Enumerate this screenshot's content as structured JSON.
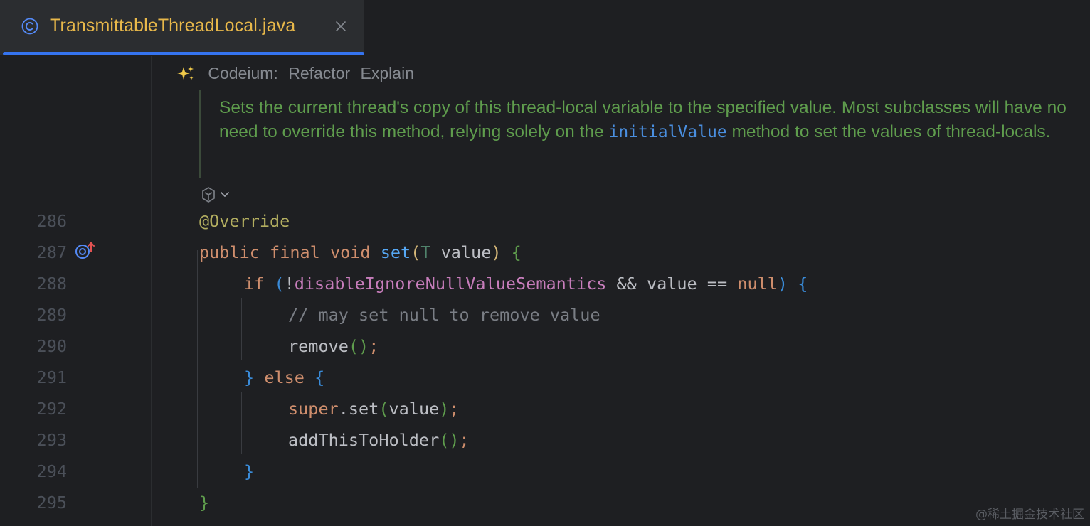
{
  "tab": {
    "title": "TransmittableThreadLocal.java",
    "file_type_icon": "class-c-icon",
    "close_icon": "close-x-icon",
    "accent_color": "#3574f0"
  },
  "codeium_lens": {
    "icon": "sparkle-icon",
    "label": "Codeium:",
    "actions": [
      "Refactor",
      "Explain"
    ]
  },
  "doc_comment": {
    "part1": "Sets the current thread's copy of this thread-local variable to the specified value. Most subclasses will have no need to override this method, relying solely on the ",
    "code_ref": "initialValue",
    "part2": " method to set the values of thread-locals.",
    "toggle_icon": "ai-render-toggle-icon"
  },
  "gutter": {
    "override_marker_icon": "overrides-method-icon"
  },
  "lines": [
    {
      "number": "286",
      "tokens": [
        {
          "t": "@Override",
          "c": "ann"
        }
      ]
    },
    {
      "number": "287",
      "tokens": [
        {
          "t": "public",
          "c": "kw"
        },
        {
          "t": " ",
          "c": "plain"
        },
        {
          "t": "final",
          "c": "kw"
        },
        {
          "t": " ",
          "c": "plain"
        },
        {
          "t": "void",
          "c": "kw"
        },
        {
          "t": " ",
          "c": "plain"
        },
        {
          "t": "set",
          "c": "fn"
        },
        {
          "t": "(",
          "c": "p1"
        },
        {
          "t": "T",
          "c": "tp"
        },
        {
          "t": " value",
          "c": "plain"
        },
        {
          "t": ")",
          "c": "p1"
        },
        {
          "t": " ",
          "c": "plain"
        },
        {
          "t": "{",
          "c": "p2"
        }
      ]
    },
    {
      "number": "288",
      "tokens": [
        {
          "t": "if",
          "c": "kw"
        },
        {
          "t": " ",
          "c": "plain"
        },
        {
          "t": "(",
          "c": "p3"
        },
        {
          "t": "!",
          "c": "plain"
        },
        {
          "t": "disableIgnoreNullValueSemantics",
          "c": "fld"
        },
        {
          "t": " && value == ",
          "c": "plain"
        },
        {
          "t": "null",
          "c": "kw"
        },
        {
          "t": ")",
          "c": "p3"
        },
        {
          "t": " ",
          "c": "plain"
        },
        {
          "t": "{",
          "c": "p3"
        }
      ]
    },
    {
      "number": "289",
      "tokens": [
        {
          "t": "// may set null to remove value",
          "c": "cmt"
        }
      ]
    },
    {
      "number": "290",
      "tokens": [
        {
          "t": "remove",
          "c": "plain"
        },
        {
          "t": "()",
          "c": "p2"
        },
        {
          "t": ";",
          "c": "kw"
        }
      ]
    },
    {
      "number": "291",
      "tokens": [
        {
          "t": "}",
          "c": "p3"
        },
        {
          "t": " ",
          "c": "plain"
        },
        {
          "t": "else",
          "c": "kw"
        },
        {
          "t": " ",
          "c": "plain"
        },
        {
          "t": "{",
          "c": "p3"
        }
      ]
    },
    {
      "number": "292",
      "tokens": [
        {
          "t": "super",
          "c": "kw"
        },
        {
          "t": ".set",
          "c": "plain"
        },
        {
          "t": "(",
          "c": "p2"
        },
        {
          "t": "value",
          "c": "plain"
        },
        {
          "t": ")",
          "c": "p2"
        },
        {
          "t": ";",
          "c": "kw"
        }
      ]
    },
    {
      "number": "293",
      "tokens": [
        {
          "t": "addThisToHolder",
          "c": "plain"
        },
        {
          "t": "()",
          "c": "p2"
        },
        {
          "t": ";",
          "c": "kw"
        }
      ]
    },
    {
      "number": "294",
      "tokens": [
        {
          "t": "}",
          "c": "p3"
        }
      ]
    },
    {
      "number": "295",
      "tokens": [
        {
          "t": "}",
          "c": "p2"
        }
      ]
    }
  ],
  "watermark": "@稀土掘金技术社区"
}
